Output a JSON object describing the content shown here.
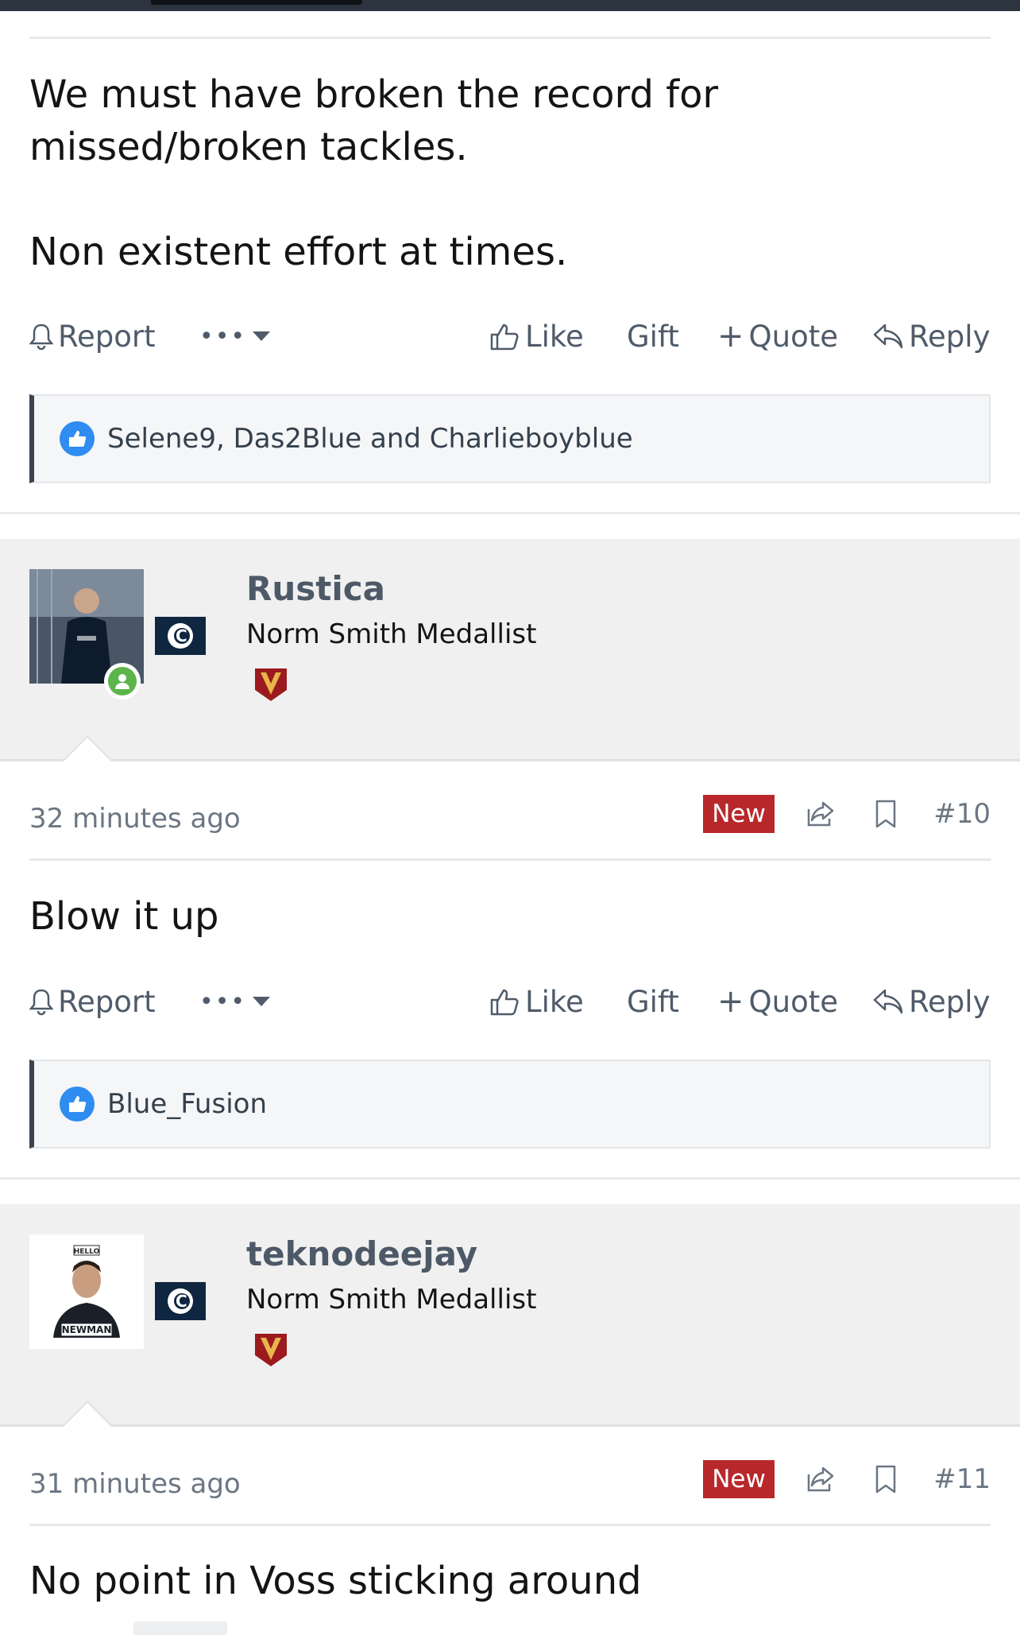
{
  "post_9": {
    "body_lines": [
      "We must have broken the record for",
      "missed/broken tackles."
    ],
    "body_line_2": "Non existent effort at times.",
    "actions": {
      "report": "Report",
      "more": "•••",
      "like": "Like",
      "gift": "Gift",
      "quote": "Quote",
      "reply": "Reply"
    },
    "likes": "Selene9, Das2Blue and Charlieboyblue"
  },
  "post_10": {
    "username": "Rustica",
    "user_title": "Norm Smith Medallist",
    "timestamp": "32 minutes ago",
    "new_badge": "New",
    "post_number": "#10",
    "body": "Blow it up",
    "actions": {
      "report": "Report",
      "more": "•••",
      "like": "Like",
      "gift": "Gift",
      "quote": "Quote",
      "reply": "Reply"
    },
    "likes": "Blue_Fusion"
  },
  "post_11": {
    "username": "teknodeejay",
    "user_title": "Norm Smith Medallist",
    "avatar_text_top": "HELLO",
    "avatar_text_bottom": "NEWMAN",
    "timestamp": "31 minutes ago",
    "new_badge": "New",
    "post_number": "#11",
    "body": "No point in Voss sticking around"
  },
  "colors": {
    "new_badge": "#b8282b",
    "like_blue": "#2f8cf0",
    "online_green": "#5bb54b",
    "username": "#4d5966",
    "action_text": "#4f5b69",
    "user_block_bg": "#f0f0f0"
  },
  "icons": [
    "bell-icon",
    "ellipsis-icon",
    "caret-down-icon",
    "thumbs-up-icon",
    "plus-icon",
    "reply-arrow-icon",
    "like-reaction-icon",
    "share-icon",
    "bookmark-icon",
    "online-status-icon",
    "club-logo-icon",
    "v-badge-icon"
  ]
}
